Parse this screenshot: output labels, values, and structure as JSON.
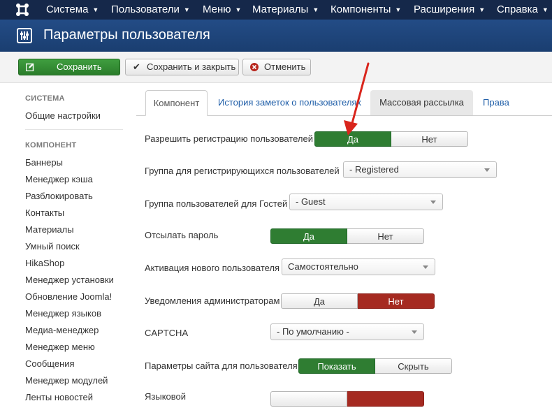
{
  "topnav": {
    "menus": [
      {
        "label": "Система"
      },
      {
        "label": "Пользователи"
      },
      {
        "label": "Меню"
      },
      {
        "label": "Материалы"
      },
      {
        "label": "Компоненты"
      },
      {
        "label": "Расширения"
      },
      {
        "label": "Справка"
      }
    ]
  },
  "header": {
    "title": "Параметры пользователя"
  },
  "toolbar": {
    "save_label": "Сохранить",
    "save_close_label": "Сохранить и закрыть",
    "cancel_label": "Отменить"
  },
  "sidebar": {
    "system_heading": "СИСТЕМА",
    "system_items": [
      "Общие настройки"
    ],
    "component_heading": "КОМПОНЕНТ",
    "component_items": [
      "Баннеры",
      "Менеджер кэша",
      "Разблокировать",
      "Контакты",
      "Материалы",
      "Умный поиск",
      "HikaShop",
      "Менеджер установки",
      "Обновление Joomla!",
      "Менеджер языков",
      "Медиа-менеджер",
      "Менеджер меню",
      "Сообщения",
      "Менеджер модулей",
      "Ленты новостей"
    ]
  },
  "tabs": [
    {
      "label": "Компонент",
      "active": true
    },
    {
      "label": "История заметок о пользователях"
    },
    {
      "label": "Массовая рассылка"
    },
    {
      "label": "Права"
    }
  ],
  "form": {
    "allow_registration": {
      "label": "Разрешить регистрацию пользователей",
      "yes": "Да",
      "no": "Нет",
      "value": "Да"
    },
    "registration_group": {
      "label": "Группа для регистрирующихся пользователей",
      "value": "- Registered"
    },
    "guest_group": {
      "label": "Группа пользователей для Гостей",
      "value": "- Guest"
    },
    "send_password": {
      "label": "Отсылать пароль",
      "yes": "Да",
      "no": "Нет",
      "value": "Да"
    },
    "activation": {
      "label": "Активация нового пользователя",
      "value": "Самостоятельно"
    },
    "admin_notify": {
      "label": "Уведомления администраторам",
      "yes": "Да",
      "no": "Нет",
      "value": "Нет"
    },
    "captcha": {
      "label": "CAPTCHA",
      "value": "- По умолчанию -"
    },
    "frontend_params": {
      "label": "Параметры сайта для пользователя",
      "show": "Показать",
      "hide": "Скрыть",
      "value": "Показать"
    },
    "next_row": {
      "label": "Языковой"
    }
  },
  "colors": {
    "nav_bg": "#15284a",
    "header_bg": "#1f4680",
    "toggle_green": "#2f7d32",
    "toggle_red": "#a52a21",
    "link": "#1f5ea8",
    "annotation_arrow": "#d9251c"
  }
}
